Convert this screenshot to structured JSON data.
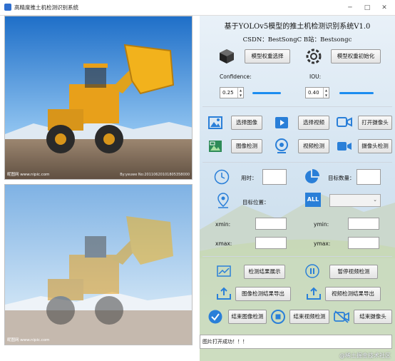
{
  "window": {
    "title": "高精度推土机检测识别系统",
    "min": "─",
    "max": "□",
    "close": "✕"
  },
  "images": {
    "top_watermark_left": "昵图网 www.nipic.com",
    "top_watermark_right": "By:yeuwe  No:20110620101805358000",
    "bottom_watermark_left": "昵图网 www.nipic.com"
  },
  "header": {
    "title": "基于YOLOv5模型的推土机检测识别系统V1.0",
    "credits": "CSDN：BestSongC   B站：Bestsongc"
  },
  "model": {
    "select_weights": "模型权重选择",
    "init_weights": "模型权重初始化"
  },
  "params": {
    "confidence_label": "Confidence:",
    "confidence_value": "0.25",
    "iou_label": "IOU:",
    "iou_value": "0.40",
    "confidence_fraction": 0.25,
    "iou_fraction": 0.4
  },
  "actions": {
    "select_image": "选择图像",
    "select_video": "选择视频",
    "open_camera": "打开摄像头",
    "image_detect": "图像检测",
    "video_detect": "视频检测",
    "camera_detect": "摄像头检测"
  },
  "stats": {
    "time_label": "用时：",
    "count_label": "目标数量：",
    "position_label": "目标位置：",
    "all_icon_text": "ALL"
  },
  "coords": {
    "xmin": "xmin:",
    "ymin": "ymin:",
    "xmax": "xmax:",
    "ymax": "ymax:"
  },
  "results": {
    "show_results": "检测结果展示",
    "pause_video": "暂停视频检测",
    "export_image": "图像检测结果导出",
    "export_video": "视频检测结果导出",
    "end_image": "结束图像检测",
    "end_video": "结束视频检测",
    "end_camera": "结束摄像头"
  },
  "status_text": "图片打开成功！！！",
  "site_watermark": "@稀土掘金技术社区",
  "colors": {
    "accent": "#1c8cf0",
    "icon_blue": "#2a7fd8",
    "loader_yellow": "#f2b21c"
  }
}
